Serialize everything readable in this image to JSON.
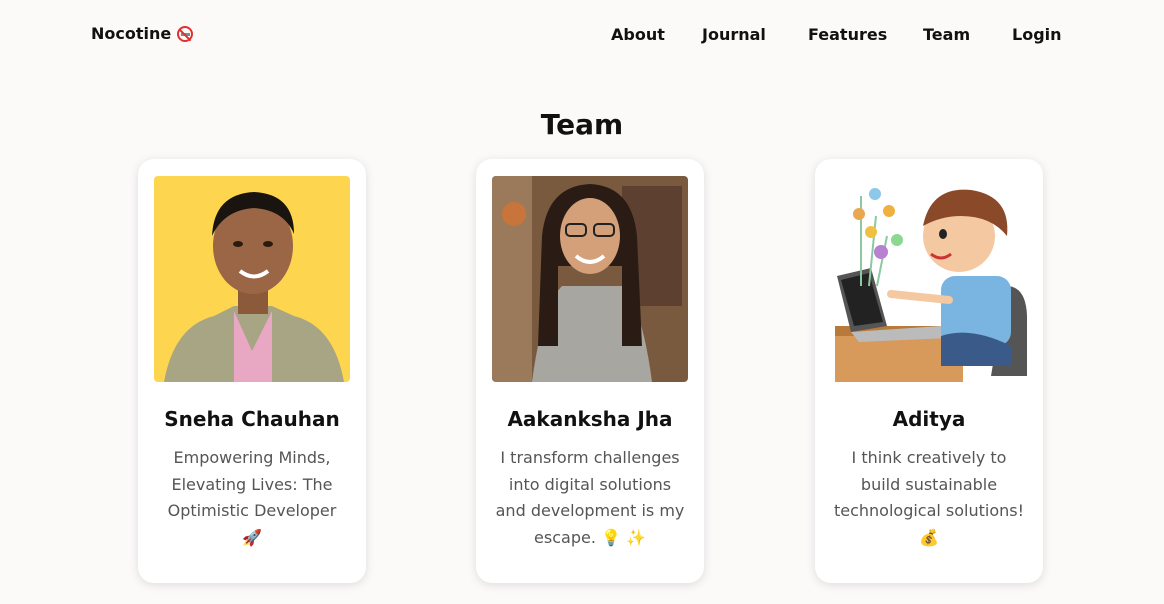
{
  "nav": {
    "brand": "Nocotine",
    "brand_icon": "no-smoking-icon",
    "links": [
      "About",
      "Journal",
      "Features",
      "Team",
      "Login"
    ]
  },
  "section": {
    "title": "Team"
  },
  "members": [
    {
      "name": "Sneha Chauhan",
      "bio": "Empowering Minds, Elevating Lives: The Optimistic Developer 🚀",
      "photo_bg": "#fed54f"
    },
    {
      "name": "Aakanksha Jha",
      "bio": "I transform challenges into digital solutions and development is my escape. 💡 ✨",
      "photo_bg": "#7a5a3e"
    },
    {
      "name": "Aditya",
      "bio": "I think creatively to build sustainable technological solutions! 💰",
      "photo_bg": "#ffffff"
    }
  ],
  "colors": {
    "page_bg": "#fcfaf9",
    "card_bg": "#ffffff",
    "text": "#111111",
    "muted": "#555555"
  }
}
